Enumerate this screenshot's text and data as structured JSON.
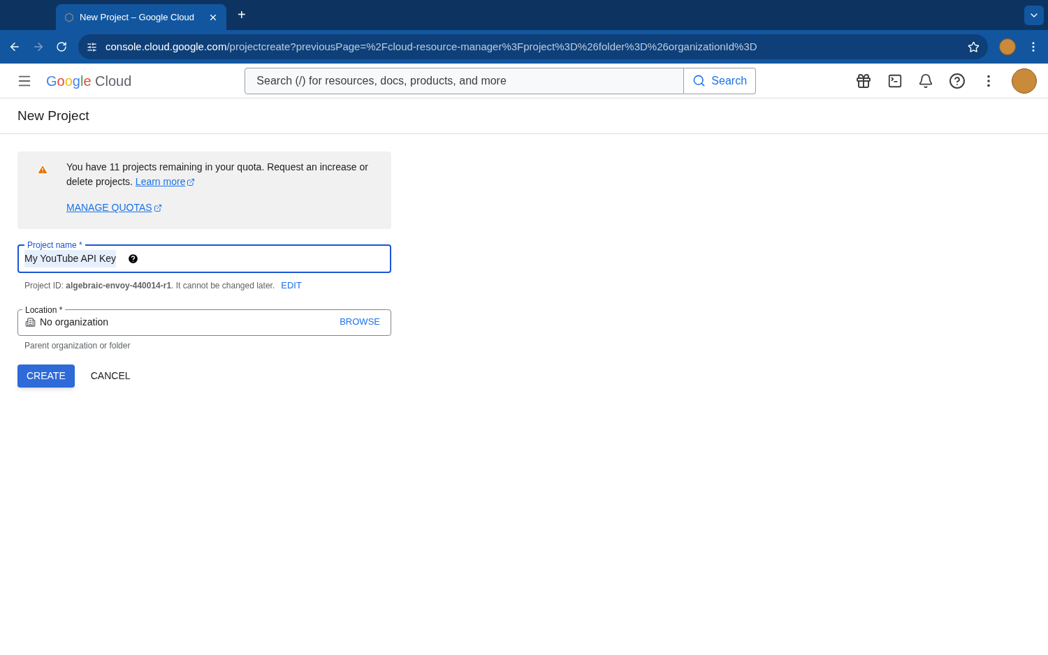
{
  "browser": {
    "tabs": [
      {
        "title": "New Project – Google Cloud",
        "selected": true
      }
    ],
    "new_tab": "+",
    "url": {
      "host": "console.cloud.google.com",
      "path": "/projectcreate?previousPage=%2Fcloud-resource-manager%3Fproject%3D%26folder%3D%26organizationId%3D"
    }
  },
  "header": {
    "logo": {
      "brand": "Google",
      "product": "Cloud"
    },
    "search": {
      "placeholder": "Search (/) for resources, docs, products, and more",
      "button": "Search"
    }
  },
  "page": {
    "title": "New Project"
  },
  "notice": {
    "text": "You have 11 projects remaining in your quota. Request an increase or delete projects.",
    "link": "Learn more",
    "action": "MANAGE QUOTAS"
  },
  "project_name": {
    "label": "Project name *",
    "value": "My YouTube API Key",
    "focused": true
  },
  "project_id": {
    "text": "Project ID: **algebraic-envoy-440014-r1**. It cannot be changed later.",
    "action": "EDIT"
  },
  "location": {
    "label": "Location *",
    "value": "No organization",
    "action": "BROWSE",
    "hint": "Parent organization or folder"
  },
  "buttons": [
    {
      "label": "CREATE",
      "kind": "primary"
    },
    {
      "label": "CANCEL",
      "kind": "text"
    }
  ]
}
